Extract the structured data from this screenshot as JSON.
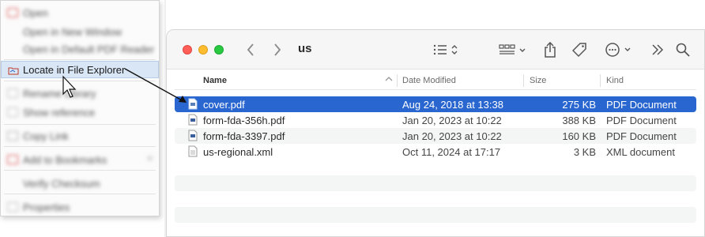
{
  "context_menu": {
    "items": [
      {
        "label": "Open",
        "blurred": true
      },
      {
        "label": "Open in New Window",
        "blurred": true
      },
      {
        "label": "Open in Default PDF Reader",
        "blurred": true
      },
      {
        "label": "Locate in File Explorer",
        "blurred": false,
        "active": true
      },
      {
        "label": "Rename Library",
        "blurred": true
      },
      {
        "label": "Show reference",
        "blurred": true
      },
      {
        "label": "Copy Link",
        "blurred": true
      },
      {
        "label": "Add to Bookmarks",
        "blurred": true
      },
      {
        "label": "Verify Checksum",
        "blurred": true
      },
      {
        "label": "Properties",
        "blurred": true
      }
    ]
  },
  "finder": {
    "title": "us",
    "icons": [
      "back-icon",
      "forward-icon",
      "list-view-icon",
      "group-icon",
      "share-icon",
      "tag-icon",
      "more-icon",
      "overflow-icon",
      "search-icon"
    ],
    "columns": {
      "name": "Name",
      "date": "Date Modified",
      "size": "Size",
      "kind": "Kind"
    },
    "files": [
      {
        "name": "cover.pdf",
        "date": "Aug 24, 2018 at 13:38",
        "size": "275 KB",
        "kind": "PDF Document",
        "selected": true
      },
      {
        "name": "form-fda-356h.pdf",
        "date": "Jan 20, 2023 at 10:22",
        "size": "388 KB",
        "kind": "PDF Document"
      },
      {
        "name": "form-fda-3397.pdf",
        "date": "Jan 20, 2023 at 10:22",
        "size": "160 KB",
        "kind": "PDF Document"
      },
      {
        "name": "us-regional.xml",
        "date": "Oct 11, 2024 at 17:17",
        "size": "3 KB",
        "kind": "XML document"
      }
    ]
  },
  "colors": {
    "selection": "#2966cf",
    "menu_highlight": "#d9e6f5"
  }
}
